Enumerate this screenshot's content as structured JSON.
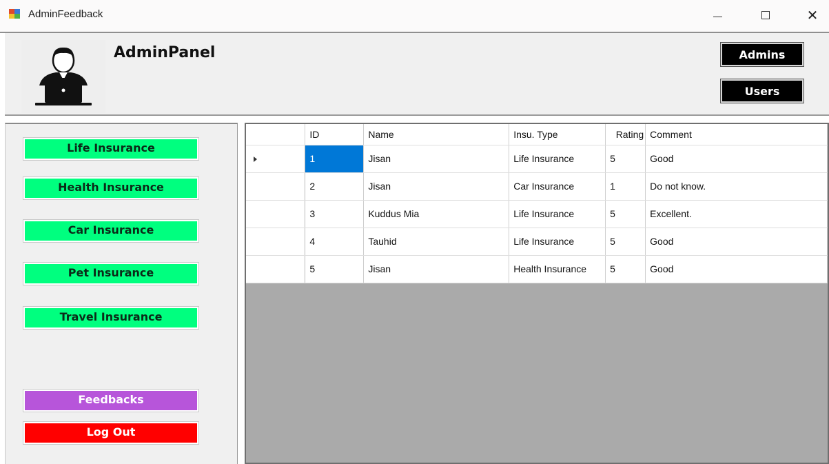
{
  "window": {
    "title": "AdminFeedback",
    "controls": {
      "minimize": "minimize-icon",
      "maximize": "maximize-icon",
      "close": "✕"
    }
  },
  "header": {
    "title": "AdminPanel",
    "avatar_icon": "admin-laptop-icon",
    "buttons": {
      "admins": "Admins",
      "users": "Users"
    }
  },
  "sidebar": {
    "items": [
      {
        "label": "Life Insurance",
        "color": "#00ff7f"
      },
      {
        "label": "Health Insurance",
        "color": "#00ff7f"
      },
      {
        "label": "Car Insurance",
        "color": "#00ff7f"
      },
      {
        "label": "Pet Insurance",
        "color": "#00ff7f"
      },
      {
        "label": "Travel Insurance",
        "color": "#00ff7f"
      }
    ],
    "feedbacks": {
      "label": "Feedbacks",
      "color": "#b755da"
    },
    "logout": {
      "label": "Log Out",
      "color": "#ff0000"
    }
  },
  "grid": {
    "columns": [
      "ID",
      "Name",
      "Insu. Type",
      "Rating",
      "Comment"
    ],
    "rows": [
      [
        "1",
        "Jisan",
        "Life Insurance",
        "5",
        "Good"
      ],
      [
        "2",
        "Jisan",
        "Car Insurance",
        "1",
        "Do not know."
      ],
      [
        "3",
        "Kuddus Mia",
        "Life Insurance",
        "5",
        "Excellent."
      ],
      [
        "4",
        "Tauhid",
        "Life Insurance",
        "5",
        "Good"
      ],
      [
        "5",
        "Jisan",
        "Health Insurance",
        "5",
        "Good"
      ]
    ],
    "selected_row": 0,
    "selection_color": "#0078d7"
  }
}
